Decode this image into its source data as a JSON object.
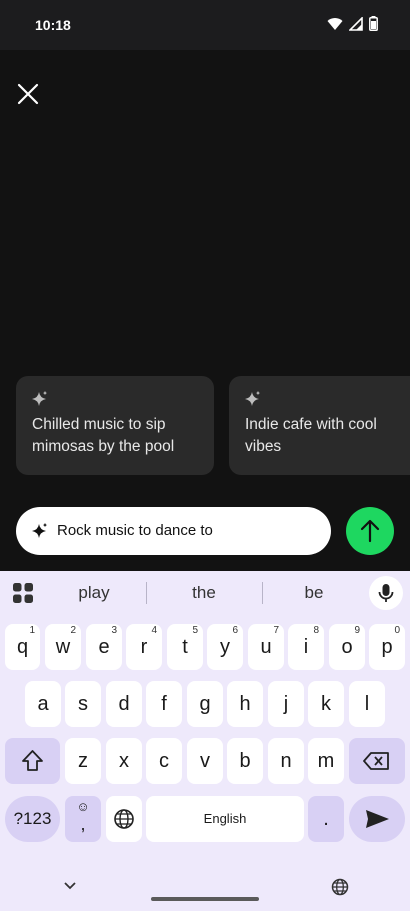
{
  "status": {
    "time": "10:18"
  },
  "suggestions_cards": [
    {
      "text": "Chilled music to sip mimosas by the pool"
    },
    {
      "text": "Indie cafe with cool vibes"
    }
  ],
  "prompt": {
    "value": "Rock music to dance to"
  },
  "keyboard": {
    "suggestions": [
      "play",
      "the",
      "be"
    ],
    "row1": [
      {
        "k": "q",
        "n": "1"
      },
      {
        "k": "w",
        "n": "2"
      },
      {
        "k": "e",
        "n": "3"
      },
      {
        "k": "r",
        "n": "4"
      },
      {
        "k": "t",
        "n": "5"
      },
      {
        "k": "y",
        "n": "6"
      },
      {
        "k": "u",
        "n": "7"
      },
      {
        "k": "i",
        "n": "8"
      },
      {
        "k": "o",
        "n": "9"
      },
      {
        "k": "p",
        "n": "0"
      }
    ],
    "row2": [
      "a",
      "s",
      "d",
      "f",
      "g",
      "h",
      "j",
      "k",
      "l"
    ],
    "row3": [
      "z",
      "x",
      "c",
      "v",
      "b",
      "n",
      "m"
    ],
    "symbols_label": "?123",
    "emoji_label": "☺",
    "comma_label": ",",
    "space_label": "English",
    "period_label": "."
  },
  "colors": {
    "accent_green": "#1ed760",
    "keyboard_bg": "#eee9fb",
    "func_key": "#d8d0f4"
  }
}
